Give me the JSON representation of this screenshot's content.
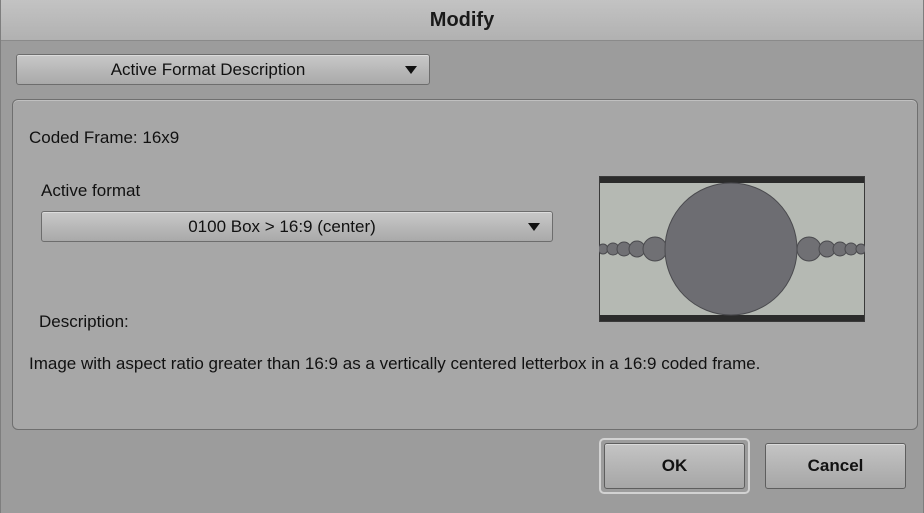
{
  "window": {
    "title": "Modify"
  },
  "mode_select": {
    "value": "Active Format Description"
  },
  "panel": {
    "coded_frame": "Coded Frame: 16x9",
    "active_format_label": "Active format",
    "active_format_value": "0100 Box > 16:9 (center)",
    "description_label": "Description:",
    "description_text": "Image with aspect ratio greater than 16:9 as a vertically centered letterbox in a 16:9 coded frame."
  },
  "buttons": {
    "ok": "OK",
    "cancel": "Cancel"
  },
  "icons": {
    "dropdown_arrow": "chevron-down-icon",
    "preview": "letterbox-preview-image"
  },
  "colors": {
    "window_bg": "#9c9c9c",
    "panel_bg": "#a7a7a7",
    "title_bg": "#b8b8b8",
    "preview_bg": "#b5b9b3",
    "preview_bars": "#2b2b2b",
    "circle_fill": "#6f6f73"
  }
}
